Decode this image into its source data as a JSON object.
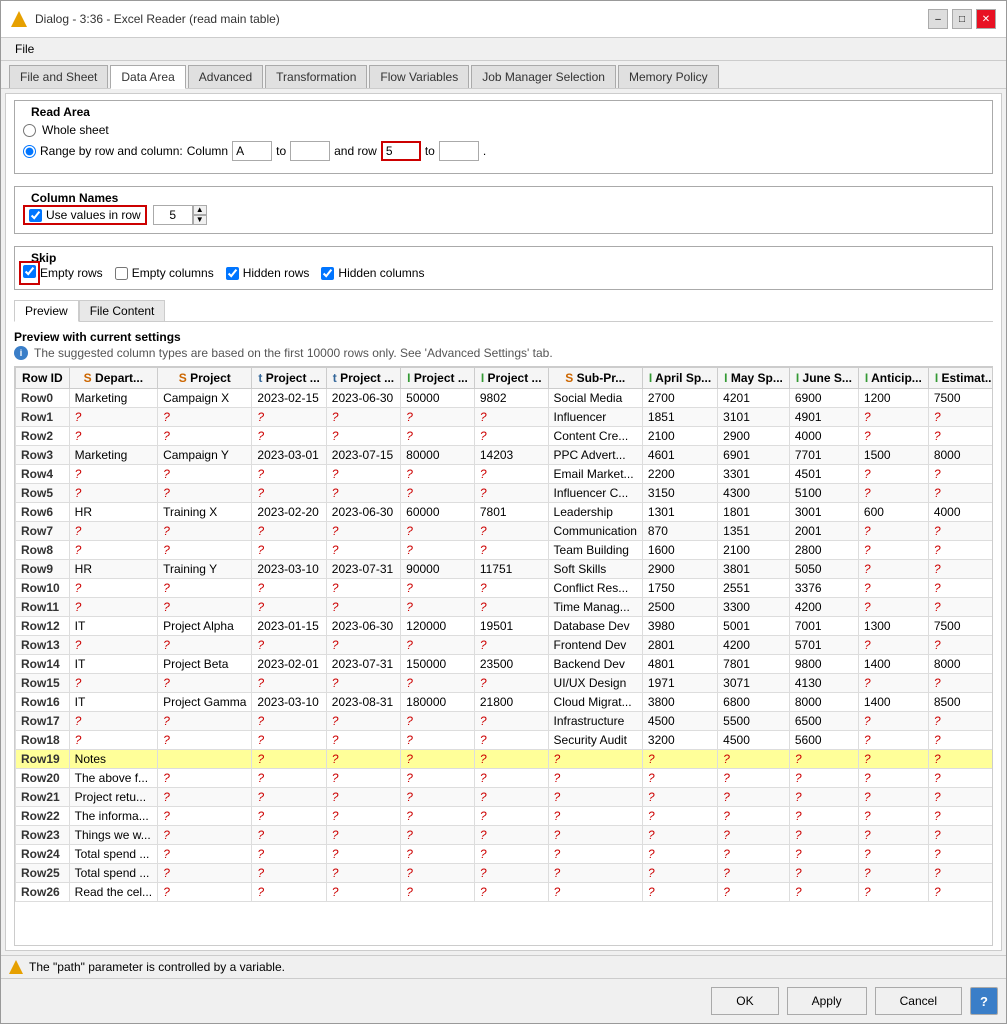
{
  "window": {
    "title": "Dialog - 3:36 - Excel Reader (read main table)",
    "menu": "File"
  },
  "tabs": {
    "items": [
      "File and Sheet",
      "Data Area",
      "Advanced",
      "Transformation",
      "Flow Variables",
      "Job Manager Selection",
      "Memory Policy"
    ],
    "active": "Data Area"
  },
  "read_area": {
    "title": "Read Area",
    "whole_sheet_label": "Whole sheet",
    "range_label": "Range by row and column:",
    "column_label": "Column",
    "column_value": "A",
    "to_label": "to",
    "and_row_label": "and row",
    "row_value": "5",
    "to2_label": "to",
    "dot": "."
  },
  "col_names": {
    "title": "Column Names",
    "checkbox_label": "Use values in row",
    "spinner_value": "5"
  },
  "skip": {
    "title": "Skip",
    "items": [
      "Empty rows",
      "Empty columns",
      "Hidden rows",
      "Hidden columns"
    ]
  },
  "preview": {
    "tabs": [
      "Preview",
      "File Content"
    ],
    "active": "Preview",
    "title": "Preview with current settings",
    "info": "The suggested column types are based on the first 10000 rows only. See 'Advanced Settings' tab."
  },
  "table": {
    "headers": [
      "Row ID",
      "S Depart...",
      "S Project",
      "t Project ...",
      "t Project ...",
      "I Project ...",
      "I Project ...",
      "S Sub-Pr...",
      "I April Sp...",
      "I May Sp...",
      "I June S...",
      "I Anticip...",
      "I Estimat..."
    ],
    "col_types": [
      "",
      "S",
      "S",
      "t",
      "t",
      "I",
      "I",
      "S",
      "I",
      "I",
      "I",
      "I",
      "I"
    ],
    "rows": [
      {
        "id": "Row0",
        "dept": "Marketing",
        "project": "Campaign X",
        "d1": "2023-02-15",
        "d2": "2023-06-30",
        "n1": "50000",
        "n2": "9802",
        "sub": "Social Media",
        "a": "2700",
        "b": "4201",
        "c": "6900",
        "d": "1200",
        "e": "7500"
      },
      {
        "id": "Row1",
        "dept": "?",
        "project": "?",
        "d1": "?",
        "d2": "?",
        "n1": "?",
        "n2": "?",
        "sub": "Influencer",
        "a": "1851",
        "b": "3101",
        "c": "4901",
        "d": "?",
        "e": "?"
      },
      {
        "id": "Row2",
        "dept": "?",
        "project": "?",
        "d1": "?",
        "d2": "?",
        "n1": "?",
        "n2": "?",
        "sub": "Content Cre...",
        "a": "2100",
        "b": "2900",
        "c": "4000",
        "d": "?",
        "e": "?"
      },
      {
        "id": "Row3",
        "dept": "Marketing",
        "project": "Campaign Y",
        "d1": "2023-03-01",
        "d2": "2023-07-15",
        "n1": "80000",
        "n2": "14203",
        "sub": "PPC Advert...",
        "a": "4601",
        "b": "6901",
        "c": "7701",
        "d": "1500",
        "e": "8000"
      },
      {
        "id": "Row4",
        "dept": "?",
        "project": "?",
        "d1": "?",
        "d2": "?",
        "n1": "?",
        "n2": "?",
        "sub": "Email Market...",
        "a": "2200",
        "b": "3301",
        "c": "4501",
        "d": "?",
        "e": "?"
      },
      {
        "id": "Row5",
        "dept": "?",
        "project": "?",
        "d1": "?",
        "d2": "?",
        "n1": "?",
        "n2": "?",
        "sub": "Influencer C...",
        "a": "3150",
        "b": "4300",
        "c": "5100",
        "d": "?",
        "e": "?"
      },
      {
        "id": "Row6",
        "dept": "HR",
        "project": "Training X",
        "d1": "2023-02-20",
        "d2": "2023-06-30",
        "n1": "60000",
        "n2": "7801",
        "sub": "Leadership",
        "a": "1301",
        "b": "1801",
        "c": "3001",
        "d": "600",
        "e": "4000"
      },
      {
        "id": "Row7",
        "dept": "?",
        "project": "?",
        "d1": "?",
        "d2": "?",
        "n1": "?",
        "n2": "?",
        "sub": "Communication",
        "a": "870",
        "b": "1351",
        "c": "2001",
        "d": "?",
        "e": "?"
      },
      {
        "id": "Row8",
        "dept": "?",
        "project": "?",
        "d1": "?",
        "d2": "?",
        "n1": "?",
        "n2": "?",
        "sub": "Team Building",
        "a": "1600",
        "b": "2100",
        "c": "2800",
        "d": "?",
        "e": "?"
      },
      {
        "id": "Row9",
        "dept": "HR",
        "project": "Training Y",
        "d1": "2023-03-10",
        "d2": "2023-07-31",
        "n1": "90000",
        "n2": "11751",
        "sub": "Soft Skills",
        "a": "2900",
        "b": "3801",
        "c": "5050",
        "d": "?",
        "e": "?"
      },
      {
        "id": "Row10",
        "dept": "?",
        "project": "?",
        "d1": "?",
        "d2": "?",
        "n1": "?",
        "n2": "?",
        "sub": "Conflict Res...",
        "a": "1750",
        "b": "2551",
        "c": "3376",
        "d": "?",
        "e": "?"
      },
      {
        "id": "Row11",
        "dept": "?",
        "project": "?",
        "d1": "?",
        "d2": "?",
        "n1": "?",
        "n2": "?",
        "sub": "Time Manag...",
        "a": "2500",
        "b": "3300",
        "c": "4200",
        "d": "?",
        "e": "?"
      },
      {
        "id": "Row12",
        "dept": "IT",
        "project": "Project Alpha",
        "d1": "2023-01-15",
        "d2": "2023-06-30",
        "n1": "120000",
        "n2": "19501",
        "sub": "Database Dev",
        "a": "3980",
        "b": "5001",
        "c": "7001",
        "d": "1300",
        "e": "7500"
      },
      {
        "id": "Row13",
        "dept": "?",
        "project": "?",
        "d1": "?",
        "d2": "?",
        "n1": "?",
        "n2": "?",
        "sub": "Frontend Dev",
        "a": "2801",
        "b": "4200",
        "c": "5701",
        "d": "?",
        "e": "?"
      },
      {
        "id": "Row14",
        "dept": "IT",
        "project": "Project Beta",
        "d1": "2023-02-01",
        "d2": "2023-07-31",
        "n1": "150000",
        "n2": "23500",
        "sub": "Backend Dev",
        "a": "4801",
        "b": "7801",
        "c": "9800",
        "d": "1400",
        "e": "8000"
      },
      {
        "id": "Row15",
        "dept": "?",
        "project": "?",
        "d1": "?",
        "d2": "?",
        "n1": "?",
        "n2": "?",
        "sub": "UI/UX Design",
        "a": "1971",
        "b": "3071",
        "c": "4130",
        "d": "?",
        "e": "?"
      },
      {
        "id": "Row16",
        "dept": "IT",
        "project": "Project Gamma",
        "d1": "2023-03-10",
        "d2": "2023-08-31",
        "n1": "180000",
        "n2": "21800",
        "sub": "Cloud Migrat...",
        "a": "3800",
        "b": "6800",
        "c": "8000",
        "d": "1400",
        "e": "8500"
      },
      {
        "id": "Row17",
        "dept": "?",
        "project": "?",
        "d1": "?",
        "d2": "?",
        "n1": "?",
        "n2": "?",
        "sub": "Infrastructure",
        "a": "4500",
        "b": "5500",
        "c": "6500",
        "d": "?",
        "e": "?"
      },
      {
        "id": "Row18",
        "dept": "?",
        "project": "?",
        "d1": "?",
        "d2": "?",
        "n1": "?",
        "n2": "?",
        "sub": "Security Audit",
        "a": "3200",
        "b": "4500",
        "c": "5600",
        "d": "?",
        "e": "?"
      },
      {
        "id": "Row19",
        "dept": "Notes",
        "project": "",
        "d1": "?",
        "d2": "?",
        "n1": "?",
        "n2": "?",
        "sub": "?",
        "a": "?",
        "b": "?",
        "c": "?",
        "d": "?",
        "e": "?",
        "highlighted": true
      },
      {
        "id": "Row20",
        "dept": "The above f...",
        "project": "?",
        "d1": "?",
        "d2": "?",
        "n1": "?",
        "n2": "?",
        "sub": "?",
        "a": "?",
        "b": "?",
        "c": "?",
        "d": "?",
        "e": "?"
      },
      {
        "id": "Row21",
        "dept": "Project retu...",
        "project": "?",
        "d1": "?",
        "d2": "?",
        "n1": "?",
        "n2": "?",
        "sub": "?",
        "a": "?",
        "b": "?",
        "c": "?",
        "d": "?",
        "e": "?"
      },
      {
        "id": "Row22",
        "dept": "The informa...",
        "project": "?",
        "d1": "?",
        "d2": "?",
        "n1": "?",
        "n2": "?",
        "sub": "?",
        "a": "?",
        "b": "?",
        "c": "?",
        "d": "?",
        "e": "?"
      },
      {
        "id": "Row23",
        "dept": "Things we w...",
        "project": "?",
        "d1": "?",
        "d2": "?",
        "n1": "?",
        "n2": "?",
        "sub": "?",
        "a": "?",
        "b": "?",
        "c": "?",
        "d": "?",
        "e": "?"
      },
      {
        "id": "Row24",
        "dept": "Total spend ...",
        "project": "?",
        "d1": "?",
        "d2": "?",
        "n1": "?",
        "n2": "?",
        "sub": "?",
        "a": "?",
        "b": "?",
        "c": "?",
        "d": "?",
        "e": "?"
      },
      {
        "id": "Row25",
        "dept": "Total spend ...",
        "project": "?",
        "d1": "?",
        "d2": "?",
        "n1": "?",
        "n2": "?",
        "sub": "?",
        "a": "?",
        "b": "?",
        "c": "?",
        "d": "?",
        "e": "?"
      },
      {
        "id": "Row26",
        "dept": "Read the cel...",
        "project": "?",
        "d1": "?",
        "d2": "?",
        "n1": "?",
        "n2": "?",
        "sub": "?",
        "a": "?",
        "b": "?",
        "c": "?",
        "d": "?",
        "e": "?"
      }
    ]
  },
  "status": {
    "message": "The \"path\" parameter is controlled by a variable."
  },
  "buttons": {
    "ok": "OK",
    "apply": "Apply",
    "cancel": "Cancel",
    "help": "?"
  }
}
